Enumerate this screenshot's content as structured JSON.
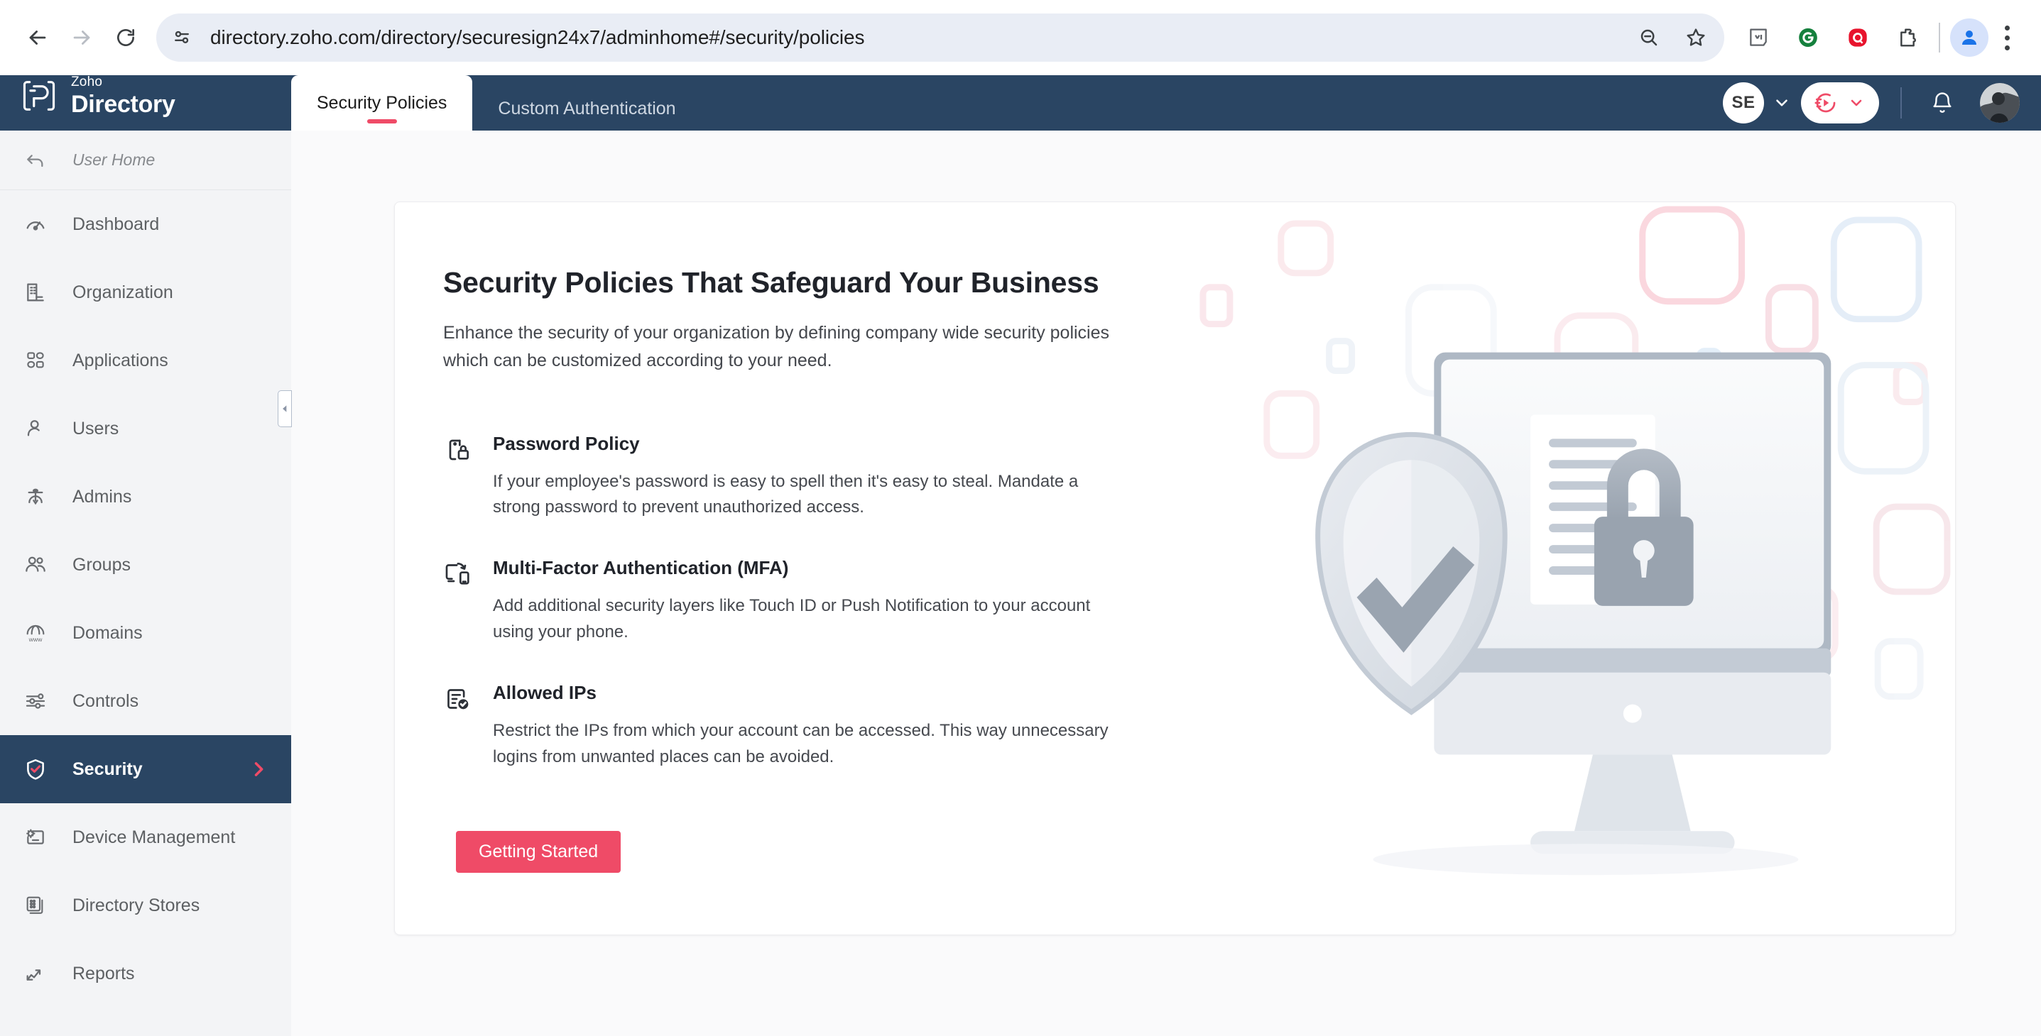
{
  "browser": {
    "url": "directory.zoho.com/directory/securesign24x7/adminhome#/security/policies",
    "back_label": "Back",
    "forward_label": "Forward",
    "reload_label": "Reload",
    "site_info_label": "View site information",
    "zoom_out_label": "Zoom out",
    "bookmark_label": "Bookmark this tab",
    "extensions": [
      {
        "name": "text-extension-icon",
        "label": "Text extension"
      },
      {
        "name": "grammarly-extension-icon",
        "label": "Grammarly"
      },
      {
        "name": "quillbot-extension-icon",
        "label": "QuillBot"
      },
      {
        "name": "extensions-puzzle-icon",
        "label": "Extensions"
      }
    ],
    "profile_label": "Profile",
    "menu_label": "Customize and control Google Chrome"
  },
  "header": {
    "brand": {
      "top": "Zoho",
      "bottom": "Directory"
    },
    "tabs": [
      {
        "label": "Security Policies",
        "active": true
      },
      {
        "label": "Custom Authentication",
        "active": false
      }
    ],
    "org_initials": "SE",
    "org_chevron_label": "Switch organization",
    "product_switcher_label": "Product switcher",
    "notifications_label": "Notifications",
    "user_avatar_label": "User profile"
  },
  "sidebar": {
    "user_home": {
      "label": "User Home",
      "icon": "back-arrow-icon"
    },
    "items": [
      {
        "label": "Dashboard",
        "icon": "gauge-icon",
        "active": false
      },
      {
        "label": "Organization",
        "icon": "building-icon",
        "active": false
      },
      {
        "label": "Applications",
        "icon": "grid-apps-icon",
        "active": false
      },
      {
        "label": "Users",
        "icon": "user-icon",
        "active": false
      },
      {
        "label": "Admins",
        "icon": "admin-hat-icon",
        "active": false
      },
      {
        "label": "Groups",
        "icon": "people-group-icon",
        "active": false
      },
      {
        "label": "Domains",
        "icon": "www-globe-icon",
        "active": false
      },
      {
        "label": "Controls",
        "icon": "sliders-icon",
        "active": false
      },
      {
        "label": "Security",
        "icon": "shield-check-icon",
        "active": true
      },
      {
        "label": "Device Management",
        "icon": "device-gear-icon",
        "active": false
      },
      {
        "label": "Directory Stores",
        "icon": "stores-icon",
        "active": false
      },
      {
        "label": "Reports",
        "icon": "chart-up-icon",
        "active": false
      }
    ],
    "collapse_label": "Collapse sidebar"
  },
  "main": {
    "title": "Security Policies That Safeguard Your Business",
    "subtitle": "Enhance the security of your organization by defining company wide security policies which can be customized according to your need.",
    "features": [
      {
        "icon": "phone-lock-icon",
        "title": "Password Policy",
        "desc": "If your employee's password is easy to spell then it's easy to steal. Mandate a strong password to prevent unauthorized access."
      },
      {
        "icon": "device-sync-icon",
        "title": "Multi-Factor Authentication (MFA)",
        "desc": "Add additional security layers like Touch ID or Push Notification to your account using your phone."
      },
      {
        "icon": "document-check-icon",
        "title": "Allowed IPs",
        "desc": "Restrict the IPs from which your account can be accessed. This way unnecessary logins from unwanted places can be avoided."
      }
    ],
    "cta_label": "Getting Started",
    "illustration_label": "security-shield-monitor-illustration"
  },
  "colors": {
    "header_navy": "#2a4563",
    "accent_red": "#ef4b67",
    "sidebar_bg": "#f3f4f6",
    "page_bg": "#fafafb",
    "card_bg": "#ffffff",
    "text_primary": "#20232a",
    "text_secondary": "#46494f"
  }
}
